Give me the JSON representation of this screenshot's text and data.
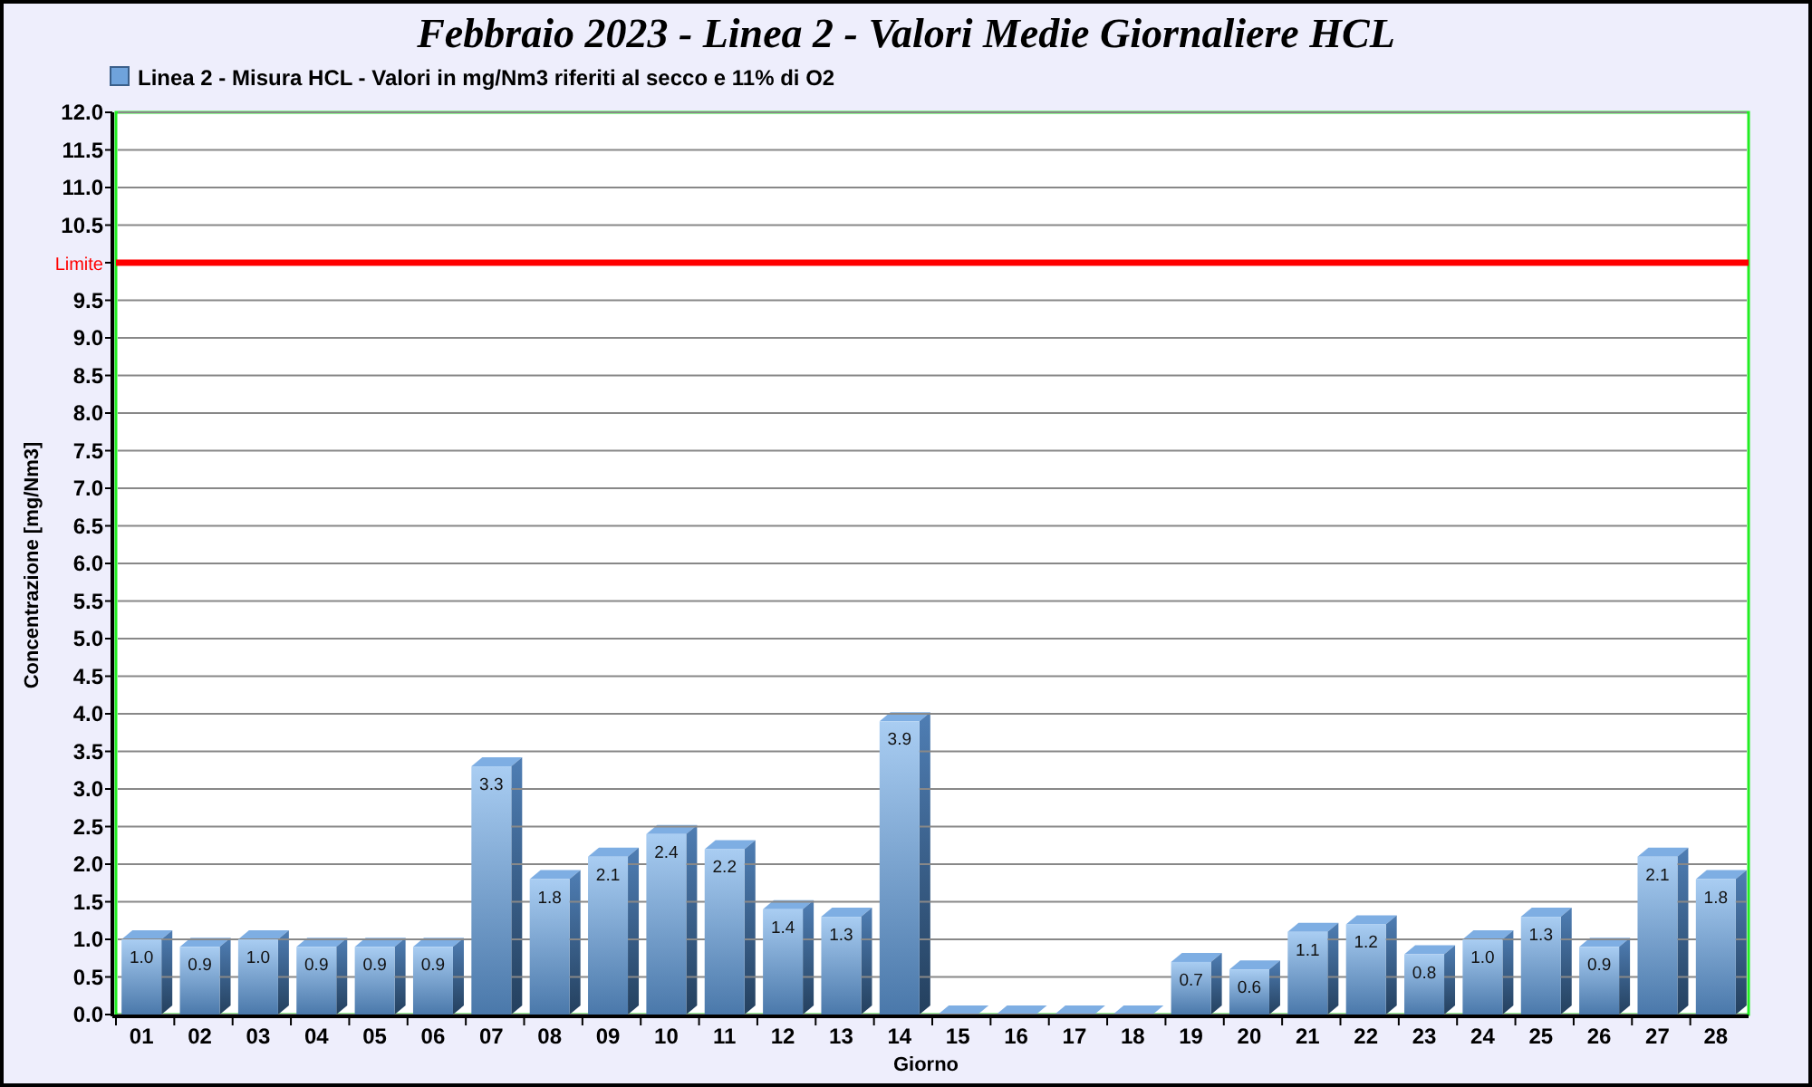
{
  "chart": {
    "chart_data": {
      "type": "bar",
      "orientation": "vertical",
      "title": "Febbraio 2023 - Linea 2 - Valori Medie Giornaliere HCL",
      "xlabel": "Giorno",
      "ylabel": "Concentrazione [mg/Nm3]",
      "categories": [
        "01",
        "02",
        "03",
        "04",
        "05",
        "06",
        "07",
        "08",
        "09",
        "10",
        "11",
        "12",
        "13",
        "14",
        "15",
        "16",
        "17",
        "18",
        "19",
        "20",
        "21",
        "22",
        "23",
        "24",
        "25",
        "26",
        "27",
        "28"
      ],
      "series": [
        {
          "name": "Linea 2 - Misura HCL - Valori in mg/Nm3 riferiti al secco e 11% di O2",
          "color": "#6fa3dc",
          "values": [
            1.0,
            0.9,
            1.0,
            0.9,
            0.9,
            0.9,
            3.3,
            1.8,
            2.1,
            2.4,
            2.2,
            1.4,
            1.3,
            3.9,
            0,
            0,
            0,
            0,
            0.7,
            0.6,
            1.1,
            1.2,
            0.8,
            1.0,
            1.3,
            0.9,
            2.1,
            1.8
          ]
        }
      ],
      "value_labels": [
        "1.0",
        "0.9",
        "1.0",
        "0.9",
        "0.9",
        "0.9",
        "3.3",
        "1.8",
        "2.1",
        "2.4",
        "2.2",
        "1.4",
        "1.3",
        "3.9",
        null,
        null,
        null,
        null,
        "0.7",
        "0.6",
        "1.1",
        "1.2",
        "0.8",
        "1.0",
        "1.3",
        "0.9",
        "2.1",
        "1.8"
      ],
      "ylim": [
        0,
        12
      ],
      "yticks": [
        {
          "value": 0,
          "label": "0.0"
        },
        {
          "value": 0.5,
          "label": "0.5"
        },
        {
          "value": 1,
          "label": "1.0"
        },
        {
          "value": 1.5,
          "label": "1.5"
        },
        {
          "value": 2,
          "label": "2.0"
        },
        {
          "value": 2.5,
          "label": "2.5"
        },
        {
          "value": 3,
          "label": "3.0"
        },
        {
          "value": 3.5,
          "label": "3.5"
        },
        {
          "value": 4,
          "label": "4.0"
        },
        {
          "value": 4.5,
          "label": "4.5"
        },
        {
          "value": 5,
          "label": "5.0"
        },
        {
          "value": 5.5,
          "label": "5.5"
        },
        {
          "value": 6,
          "label": "6.0"
        },
        {
          "value": 6.5,
          "label": "6.5"
        },
        {
          "value": 7,
          "label": "7.0"
        },
        {
          "value": 7.5,
          "label": "7.5"
        },
        {
          "value": 8,
          "label": "8.0"
        },
        {
          "value": 8.5,
          "label": "8.5"
        },
        {
          "value": 9,
          "label": "9.0"
        },
        {
          "value": 9.5,
          "label": "9.5"
        },
        {
          "value": 10,
          "label": "Limite"
        },
        {
          "value": 10.5,
          "label": "10.5"
        },
        {
          "value": 11,
          "label": "11.0"
        },
        {
          "value": 11.5,
          "label": "11.5"
        },
        {
          "value": 12,
          "label": "12.0"
        }
      ],
      "grid": true,
      "ref_lines": [
        {
          "axis": "y",
          "value": 10,
          "color": "#ff0000"
        }
      ]
    }
  }
}
